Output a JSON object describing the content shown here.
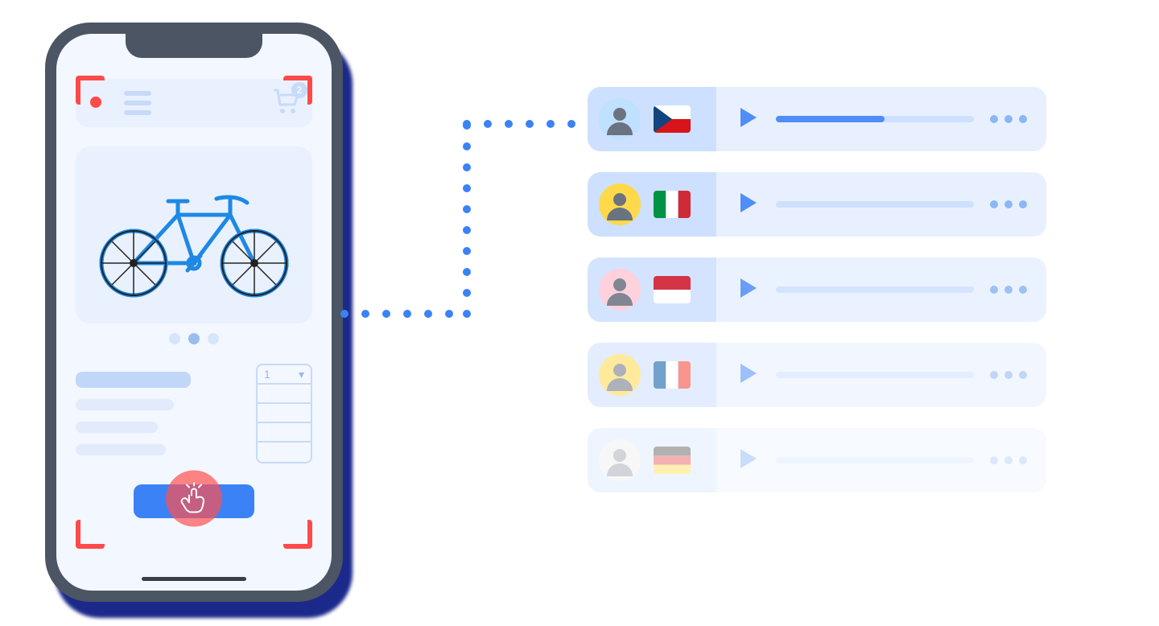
{
  "phone": {
    "cart_count": "2",
    "qty_selected": "1"
  },
  "testers": [
    {
      "country": "Czechia",
      "flag": "cz",
      "avatar_bg": "#bfe0ff",
      "progress": 55
    },
    {
      "country": "Italy",
      "flag": "it",
      "avatar_bg": "#ffd94a",
      "progress": 0
    },
    {
      "country": "Indonesia",
      "flag": "id",
      "avatar_bg": "#ffc9d8",
      "progress": 0
    },
    {
      "country": "France",
      "flag": "fr",
      "avatar_bg": "#ffd94a",
      "progress": 0
    },
    {
      "country": "Germany",
      "flag": "de",
      "avatar_bg": "#e8e8e8",
      "progress": 0
    }
  ]
}
